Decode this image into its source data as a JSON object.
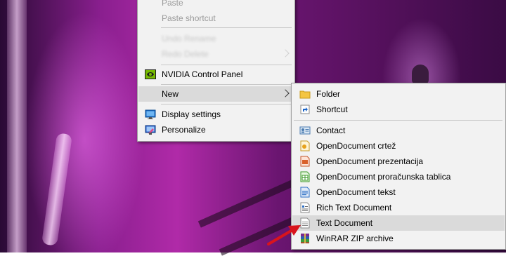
{
  "context_menu": {
    "items": [
      {
        "label": "Paste",
        "state": "disabled"
      },
      {
        "label": "Paste shortcut",
        "state": "disabled"
      },
      {
        "label": "Undo Rename",
        "state": "blurred"
      },
      {
        "label": "Redo Delete",
        "state": "blurred"
      },
      {
        "label": "NVIDIA Control Panel",
        "icon": "nvidia-icon"
      },
      {
        "label": "New",
        "icon": "",
        "state": "highlighted"
      },
      {
        "label": "Display settings",
        "icon": "display-settings-icon"
      },
      {
        "label": "Personalize",
        "icon": "personalize-icon"
      }
    ]
  },
  "new_submenu": {
    "items": [
      {
        "label": "Folder",
        "icon": "folder-icon"
      },
      {
        "label": "Shortcut",
        "icon": "shortcut-icon"
      },
      {
        "label": "Contact",
        "icon": "contact-icon"
      },
      {
        "label": "OpenDocument crtež",
        "icon": "opendocument-drawing-icon"
      },
      {
        "label": "OpenDocument prezentacija",
        "icon": "opendocument-presentation-icon"
      },
      {
        "label": "OpenDocument proračunska tablica",
        "icon": "opendocument-spreadsheet-icon"
      },
      {
        "label": "OpenDocument tekst",
        "icon": "opendocument-text-icon"
      },
      {
        "label": "Rich Text Document",
        "icon": "rich-text-icon"
      },
      {
        "label": "Text Document",
        "icon": "text-document-icon",
        "state": "highlighted"
      },
      {
        "label": "WinRAR ZIP archive",
        "icon": "winrar-icon"
      }
    ]
  },
  "colors": {
    "menu_bg": "#f2f2f2",
    "highlight": "#dadada",
    "annotation_arrow": "#d9141c"
  }
}
